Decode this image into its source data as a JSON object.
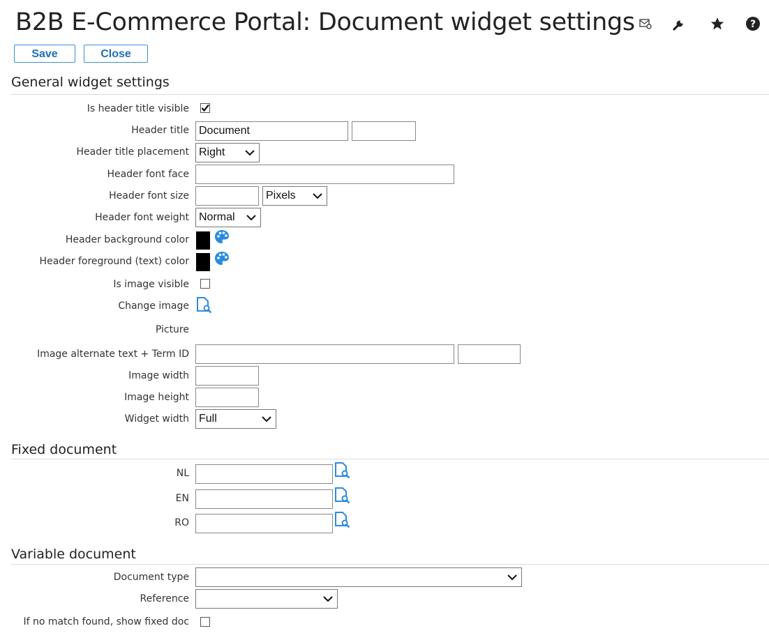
{
  "header": {
    "title": "B2B E-Commerce Portal: Document widget settings",
    "icons": [
      "mail-settings-icon",
      "wrench-icon",
      "star-icon",
      "help-icon"
    ]
  },
  "toolbar": {
    "save_label": "Save",
    "close_label": "Close"
  },
  "colors": {
    "accent": "#3c8fd6",
    "palette": "#2a8be0",
    "swatch": "#000000"
  },
  "general": {
    "heading": "General widget settings",
    "is_header_title_visible": {
      "label": "Is header title visible",
      "checked": true
    },
    "header_title": {
      "label": "Header title",
      "value": "Document",
      "term_value": ""
    },
    "header_title_placement": {
      "label": "Header title placement",
      "selected": "Right"
    },
    "header_font_face": {
      "label": "Header font face",
      "value": ""
    },
    "header_font_size": {
      "label": "Header font size",
      "value": "",
      "unit": "Pixels"
    },
    "header_font_weight": {
      "label": "Header font weight",
      "selected": "Normal"
    },
    "header_background_color": {
      "label": "Header background color",
      "color": "#000000"
    },
    "header_foreground_color": {
      "label": "Header foreground (text) color",
      "color": "#000000"
    },
    "is_image_visible": {
      "label": "Is image visible",
      "checked": false
    },
    "change_image": {
      "label": "Change image"
    },
    "picture": {
      "label": "Picture"
    },
    "image_alt_text": {
      "label": "Image alternate text + Term ID",
      "value": "",
      "term_id": ""
    },
    "image_width": {
      "label": "Image width",
      "value": ""
    },
    "image_height": {
      "label": "Image height",
      "value": ""
    },
    "widget_width": {
      "label": "Widget width",
      "selected": "Full"
    }
  },
  "fixed_document": {
    "heading": "Fixed document",
    "rows": [
      {
        "label": "NL",
        "value": ""
      },
      {
        "label": "EN",
        "value": ""
      },
      {
        "label": "RO",
        "value": ""
      }
    ]
  },
  "variable_document": {
    "heading": "Variable document",
    "document_type": {
      "label": "Document type",
      "selected": ""
    },
    "reference": {
      "label": "Reference",
      "selected": ""
    },
    "show_fixed_doc": {
      "label": "If no match found, show fixed doc",
      "checked": false
    }
  }
}
